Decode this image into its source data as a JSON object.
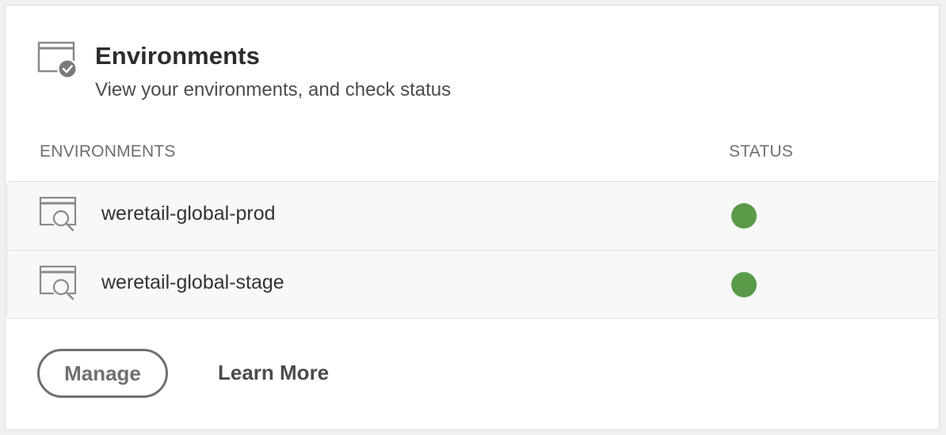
{
  "card": {
    "title": "Environments",
    "subtitle": "View your environments, and check status",
    "header_icon": "browser-check-icon"
  },
  "table": {
    "col_environments": "ENVIRONMENTS",
    "col_status": "STATUS",
    "rows": [
      {
        "name": "weretail-global-prod",
        "icon": "browser-search-icon",
        "status": "running",
        "status_color": "#5a9a48"
      },
      {
        "name": "weretail-global-stage",
        "icon": "browser-search-icon",
        "status": "running",
        "status_color": "#5a9a48"
      }
    ]
  },
  "actions": {
    "manage_label": "Manage",
    "learn_more_label": "Learn More"
  },
  "colors": {
    "status_green": "#5a9a48",
    "icon_gray": "#8a8a8a"
  }
}
